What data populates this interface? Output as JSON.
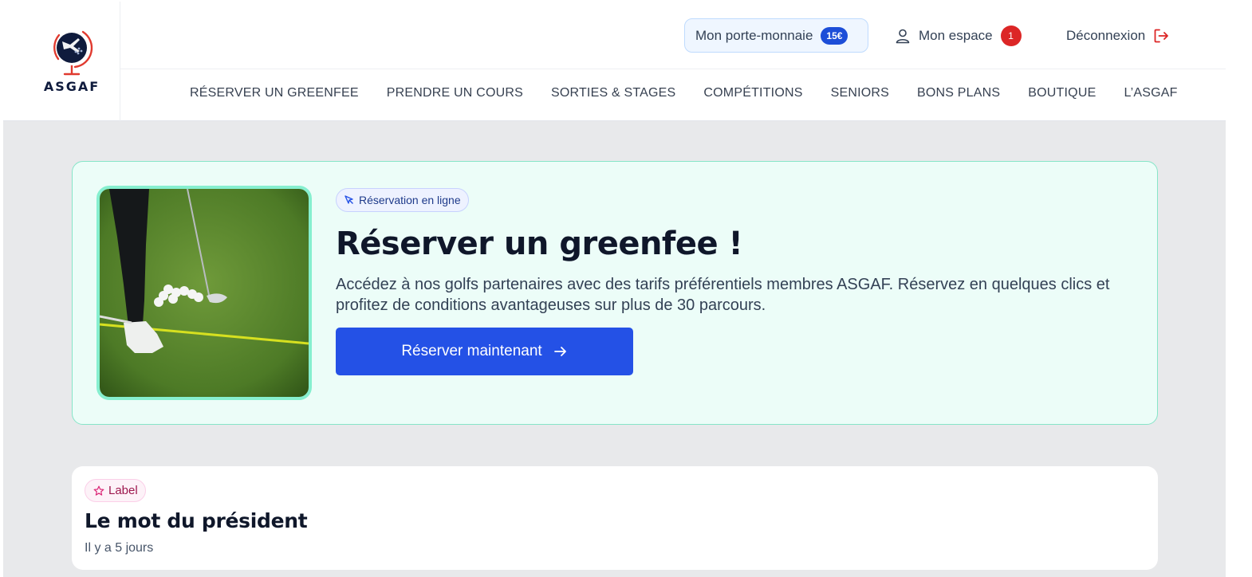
{
  "brand": {
    "name": "ASGAF"
  },
  "header": {
    "wallet_label": "Mon porte-monnaie",
    "wallet_amount": "15€",
    "espace_label": "Mon espace",
    "espace_notifications": "1",
    "logout_label": "Déconnexion"
  },
  "nav": {
    "items": [
      "RÉSERVER UN GREENFEE",
      "PRENDRE UN COURS",
      "SORTIES & STAGES",
      "COMPÉTITIONS",
      "SENIORS",
      "BONS PLANS",
      "BOUTIQUE",
      "L’ASGAF"
    ]
  },
  "hero": {
    "pill": "Réservation en ligne",
    "title": "Réserver un greenfee !",
    "description": "Accédez à nos golfs partenaires avec des tarifs préférentiels membres ASGAF. Réservez en quelques clics et profitez de conditions avantageuses sur plus de 30 parcours.",
    "button_label": "Réserver maintenant"
  },
  "card": {
    "label": "Label",
    "title": "Le mot du président",
    "time": "Il y a 5 jours"
  },
  "colors": {
    "accent": "#2451e6",
    "hero_bg": "#ecfdf8",
    "hero_border": "#86e5c8",
    "notification": "#dc2626",
    "logo_red": "#e03a2f",
    "logo_navy": "#0f1b3d"
  },
  "icons": {
    "user": "user-icon",
    "logout": "logout-icon",
    "cursor": "cursor-icon",
    "arrow": "arrow-right-icon",
    "star": "star-icon"
  }
}
